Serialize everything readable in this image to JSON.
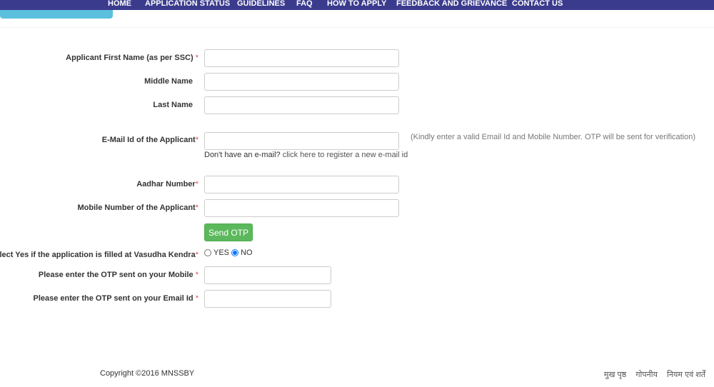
{
  "nav": {
    "items": [
      "HOME",
      "APPLICATION STATUS",
      "GUIDELINES",
      "FAQ",
      "HOW TO APPLY",
      "FEEDBACK AND GRIEVANCE",
      "CONTACT US"
    ]
  },
  "form": {
    "first_name_label": "Applicant First Name (as per SSC)",
    "middle_name_label": "Middle Name",
    "last_name_label": "Last Name",
    "email_label": "E-Mail Id of the Applicant",
    "email_help_text": "Don't have an e-mail?",
    "email_register_link": "click here to register a new e-mail id",
    "verification_note": "(Kindly enter a valid Email Id and Mobile Number. OTP will be sent for verification)",
    "aadhar_label": "Aadhar Number",
    "mobile_label": "Mobile Number of the Applicant",
    "send_otp_label": "Send OTP",
    "vasudha_label": "Select Yes if the application is filled at Vasudha Kendra",
    "vasudha_yes": "YES",
    "vasudha_no": "NO",
    "vasudha_selected": "NO",
    "otp_mobile_label": "Please enter the OTP sent on your Mobile",
    "otp_email_label": "Please enter the OTP sent on your Email Id",
    "required_mark": "*"
  },
  "footer": {
    "copyright": "Copyright ©2016 MNSSBY",
    "links": [
      "मुख पृष्ठ",
      "गोपनीय",
      "नियम एवं शर्तें"
    ]
  },
  "colors": {
    "nav": "#3b3b8e",
    "tab": "#5bc0de",
    "button": "#5cb85c",
    "required": "#d9534f"
  }
}
